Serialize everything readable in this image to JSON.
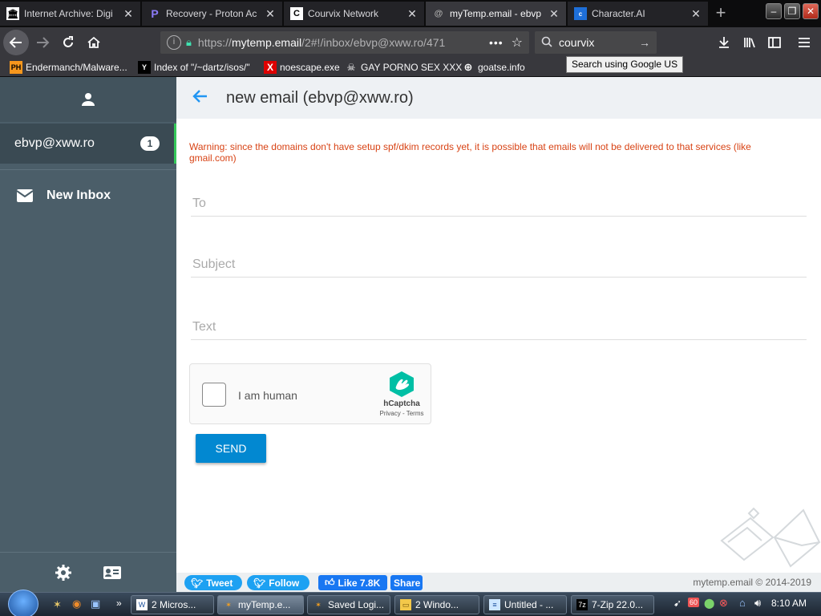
{
  "browser": {
    "tabs": [
      {
        "title": "Internet Archive: Digi",
        "icon": "IA"
      },
      {
        "title": "Recovery - Proton Ac",
        "icon": "P"
      },
      {
        "title": "Courvix Network",
        "icon": "C"
      },
      {
        "title": "myTemp.email - ebvp",
        "icon": "@"
      },
      {
        "title": "Character.AI",
        "icon": "c.ai"
      }
    ],
    "url_prefix": "https://",
    "url_domain": "mytemp.email",
    "url_path": "/2#!/inbox/ebvp@xww.ro/471",
    "search_value": "courvix",
    "search_tooltip": "Search using Google US",
    "bookmarks": [
      {
        "label": "Endermanch/Malware...",
        "icon": "PH"
      },
      {
        "label": "Index of \"/~dartz/isos/\"",
        "icon": "Y"
      },
      {
        "label": "noescape.exe",
        "icon": "X"
      },
      {
        "label": "GAY PORNO SEX XXX",
        "icon": "GP"
      },
      {
        "label": "goatse.info",
        "icon": "globe"
      }
    ]
  },
  "sidebar": {
    "account": "ebvp@xww.ro",
    "account_badge": "1",
    "new_inbox": "New Inbox"
  },
  "main": {
    "title": "new email (ebvp@xww.ro)",
    "warning": "Warning: since the domains don't have setup spf/dkim records yet, it is possible that emails will not be delivered to that services (like gmail.com)",
    "to_placeholder": "To",
    "subject_placeholder": "Subject",
    "text_placeholder": "Text",
    "captcha_label": "I am human",
    "captcha_brand": "hCaptcha",
    "captcha_links": "Privacy - Terms",
    "send_label": "SEND"
  },
  "footer": {
    "tweet": "Tweet",
    "follow": "Follow",
    "like": "Like 7.8K",
    "share": "Share",
    "copyright": "mytemp.email © 2014-2019"
  },
  "taskbar": {
    "items": [
      {
        "label": "2 Micros...",
        "icon": "W"
      },
      {
        "label": "myTemp.e...",
        "icon": "F"
      },
      {
        "label": "Saved Logi...",
        "icon": "F"
      },
      {
        "label": "2 Windo...",
        "icon": "E"
      },
      {
        "label": "Untitled - ...",
        "icon": "N"
      },
      {
        "label": "7-Zip 22.0...",
        "icon": "7z"
      }
    ],
    "tray_badge": "60",
    "clock": "8:10 AM"
  },
  "colors": {
    "sidebar": "#4b5e69",
    "accent_blue": "#0288d1",
    "warning": "#d84315",
    "active_green": "#34c759"
  }
}
